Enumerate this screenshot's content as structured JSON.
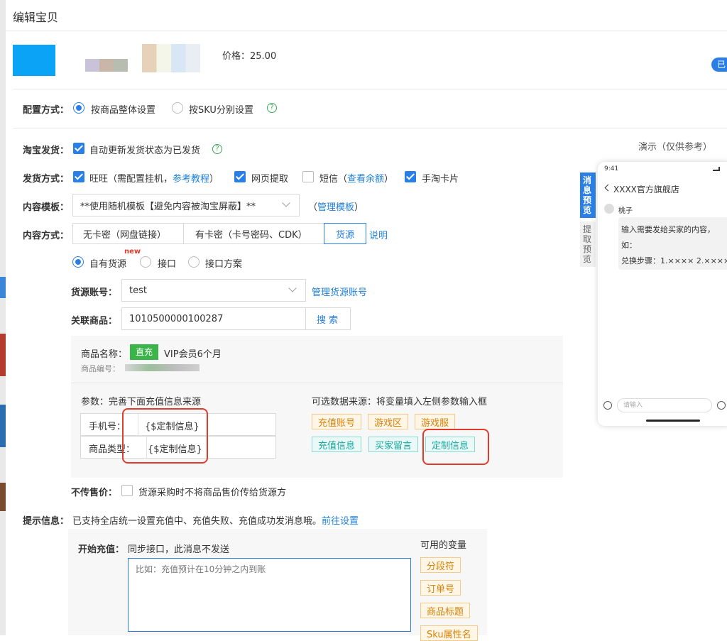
{
  "dialog": {
    "title": "编辑宝贝"
  },
  "product": {
    "price_text": "价格：25.00",
    "right_badge": "已"
  },
  "config": {
    "label": "配置方式：",
    "options": [
      "按商品整体设置",
      "按SKU分别设置"
    ]
  },
  "taobao_ship": {
    "label": "淘宝发货：",
    "checkbox_label": "自动更新发货状态为已发货"
  },
  "ship_method": {
    "label": "发货方式：",
    "wangwang": "旺旺（需配置挂机，",
    "wangwang_link": "参考教程",
    "wangwang_close": "）",
    "web": "网页提取",
    "sms": "短信（",
    "sms_link": "查看余额",
    "sms_close": "）",
    "card": "手淘卡片"
  },
  "template": {
    "label": "内容模板：",
    "selected": "**使用随机模板【避免内容被淘宝屏蔽】**",
    "manage_open": "（",
    "manage_link": "管理模板",
    "manage_close": "）"
  },
  "content_method": {
    "label": "内容方式：",
    "tabs": [
      "无卡密（网盘链接）",
      "有卡密（卡号密码、CDK）",
      "货源"
    ],
    "help_link": "说明"
  },
  "source_type": {
    "options": [
      "自有货源",
      "接口",
      "接口方案"
    ],
    "new_badge": "new"
  },
  "source_account": {
    "label": "货源账号：",
    "value": "test",
    "manage_link": "管理货源账号"
  },
  "related_product": {
    "label": "关联商品：",
    "value": "1010500000100287",
    "search_btn": "搜 索"
  },
  "product_info": {
    "name_label": "商品名称：",
    "type_badge": "直充",
    "name": "VIP会员6个月",
    "code_label": "商品编号："
  },
  "params": {
    "title": "参数：完善下面充值信息来源",
    "rows": [
      {
        "label": "手机号：",
        "value": "{$定制信息}"
      },
      {
        "label": "商品类型：",
        "value": "{$定制信息}"
      }
    ]
  },
  "optional_sources": {
    "title": "可选数据来源：将变量填入左侧参数输入框",
    "orange": [
      "充值账号",
      "游戏区",
      "游戏服"
    ],
    "teal": [
      "充值信息",
      "买家留言",
      "定制信息"
    ]
  },
  "no_price": {
    "label": "不传售价：",
    "checkbox_label": "货源采购时不将商品售价传给货源方"
  },
  "tips": {
    "label": "提示信息：",
    "text": "已支持全店统一设置充值中、充值失败、充值成功发消息哦。",
    "link": "前往设置"
  },
  "start_charge": {
    "label": "开始充值：",
    "note": "同步接口，此消息不发送",
    "placeholder": "比如：充值预计在10分钟之内到账"
  },
  "variables": {
    "title": "可用的变量",
    "items": [
      "分段符",
      "订单号",
      "商品标题",
      "Sku属性名"
    ]
  },
  "preview": {
    "title": "演示（仅供参考）",
    "tab_active": "消息预览",
    "tab_inactive": "提取预览",
    "time": "9:41",
    "shop": "XXXX官方旗舰店",
    "user": "桃子",
    "message_lines": [
      "输入需要发给买家的内容，",
      "如：",
      "兑换步骤：1.×××× 2.××××"
    ],
    "input_placeholder": "请输入"
  },
  "colors": {
    "accent": "#2a7fe6",
    "highlight": "#e23b2e"
  }
}
